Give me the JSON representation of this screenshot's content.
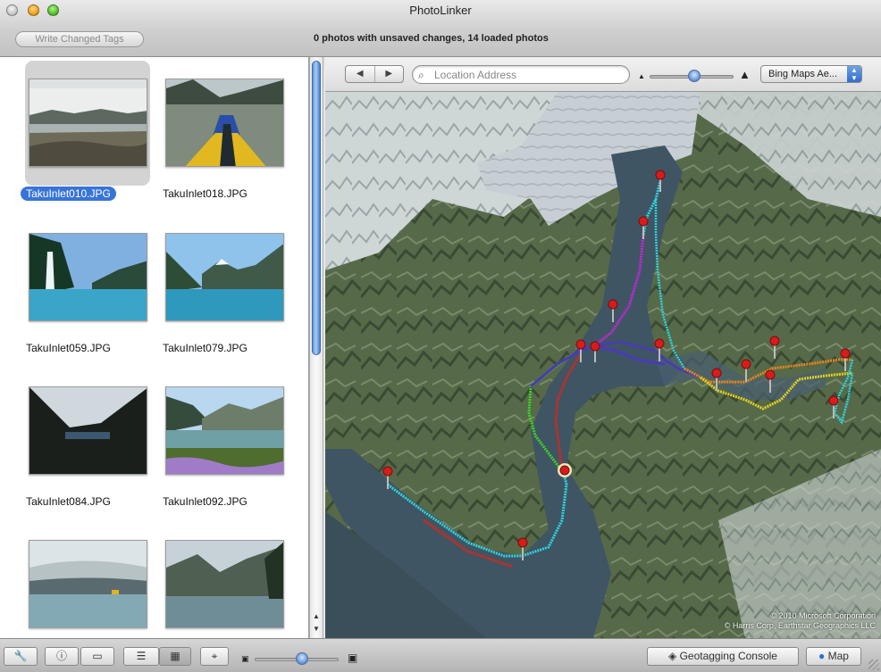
{
  "window": {
    "title": "PhotoLinker"
  },
  "toolbar": {
    "write_button": "Write Changed Tags",
    "status": "0 photos with unsaved changes, 14 loaded photos"
  },
  "photos": [
    {
      "name": "TakuInlet010.JPG",
      "selected": true
    },
    {
      "name": "TakuInlet018.JPG",
      "selected": false
    },
    {
      "name": "TakuInlet059.JPG",
      "selected": false
    },
    {
      "name": "TakuInlet079.JPG",
      "selected": false
    },
    {
      "name": "TakuInlet084.JPG",
      "selected": false
    },
    {
      "name": "TakuInlet092.JPG",
      "selected": false
    }
  ],
  "map_toolbar": {
    "back_icon": "◀",
    "forward_icon": "▶",
    "search_placeholder": "Location Address",
    "map_type": "Bing Maps Ae..."
  },
  "map": {
    "copyright_line1": "© 2010 Microsoft Corporation",
    "copyright_line2": "© Harris Corp, Earthstar Geographics LLC"
  },
  "bottom": {
    "geotag_button": "Geotagging Console",
    "map_button": "Map"
  },
  "colors": {
    "selection": "#3874d8",
    "track_cyan": "#2fd3e0",
    "track_red": "#d8261c",
    "track_purple": "#c028d8",
    "track_green": "#3fd12a",
    "track_navy": "#4a3ab8",
    "track_orange": "#e8871a",
    "track_yellow": "#e6d21c"
  }
}
